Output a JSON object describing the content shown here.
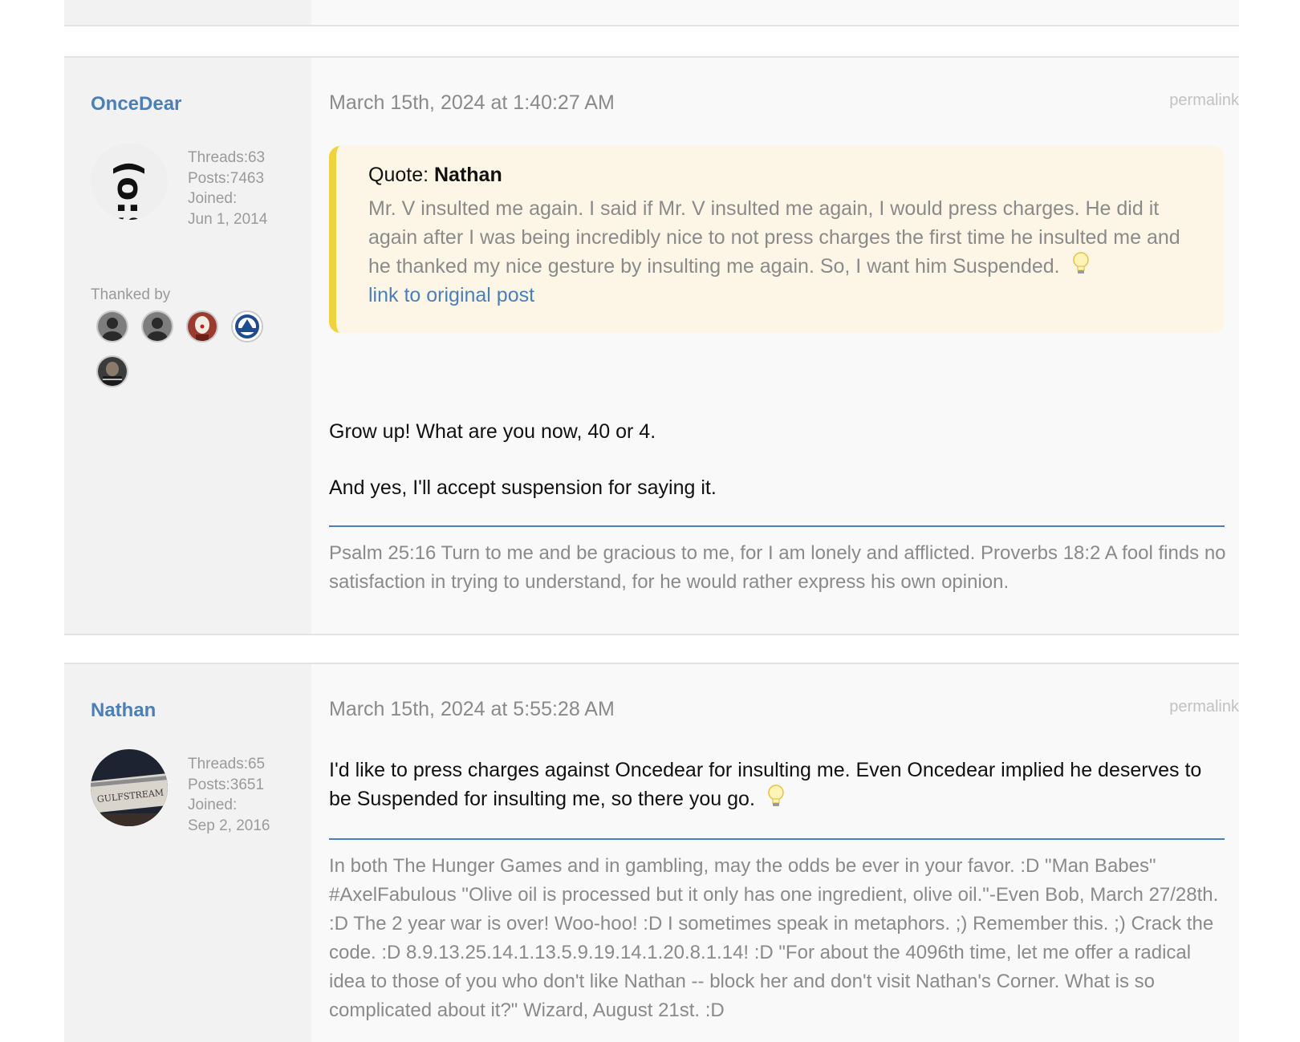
{
  "posts": [
    {
      "username": "OnceDear",
      "avatar_icon": "dollar-face-avatar",
      "threads": "Threads:63",
      "posts": "Posts:7463",
      "joined_label": "Joined:",
      "joined_date": "Jun 1, 2014",
      "thanked_by_label": "Thanked by",
      "thanked_avatars": [
        "gray-silhouette-avatar",
        "gray-silhouette-avatar",
        "clown-avatar",
        "admirals-logo-avatar",
        "dark-photo-avatar"
      ],
      "date": "March 15th, 2024 at 1:40:27 AM",
      "permalink": "permalink",
      "quote": {
        "label": "Quote: ",
        "author": "Nathan",
        "text": "Mr. V insulted me again. I said if Mr. V insulted me again, I would press charges. He did it again after I was being incredibly nice to not press charges the first time he insulted me and he thanked my nice gesture by insulting me again. So, I want him Suspended.",
        "link": "link to original post"
      },
      "body": [
        "Grow up! What are you now, 40 or 4.",
        "And yes, I'll accept suspension for saying it."
      ],
      "signature": "Psalm 25:16 Turn to me and be gracious to me, for I am lonely and afflicted. Proverbs 18:2 A fool finds no satisfaction in trying to understand, for he would rather express his own opinion."
    },
    {
      "username": "Nathan",
      "avatar_icon": "gulfstream-photo-avatar",
      "avatar_text": "GULFSTREAM",
      "threads": "Threads:65",
      "posts": "Posts:3651",
      "joined_label": "Joined:",
      "joined_date": "Sep 2, 2016",
      "date": "March 15th, 2024 at 5:55:28 AM",
      "permalink": "permalink",
      "body": "I'd like to press charges against Oncedear for insulting me. Even Oncedear implied he deserves to be Suspended for insulting me, so there you go.",
      "signature": "In both The Hunger Games and in gambling, may the odds be ever in your favor. :D \"Man Babes\" #AxelFabulous \"Olive oil is processed but it only has one ingredient, olive oil.\"-Even Bob, March 27/28th. :D The 2 year war is over! Woo-hoo! :D I sometimes speak in metaphors. ;) Remember this. ;) Crack the code. :D 8.9.13.25.14.1.13.5.9.19.14.1.20.8.1.14! :D \"For about the 4096th time, let me offer a radical idea to those of you who don't like Nathan -- block her and don't visit Nathan's Corner. What is so complicated about it?\" Wizard, August 21st. :D"
    }
  ],
  "colors": {
    "link": "#4a7fb8",
    "quote_bg": "#fdf6e6",
    "quote_bar": "#f2d140",
    "muted": "#8a8a8a"
  }
}
